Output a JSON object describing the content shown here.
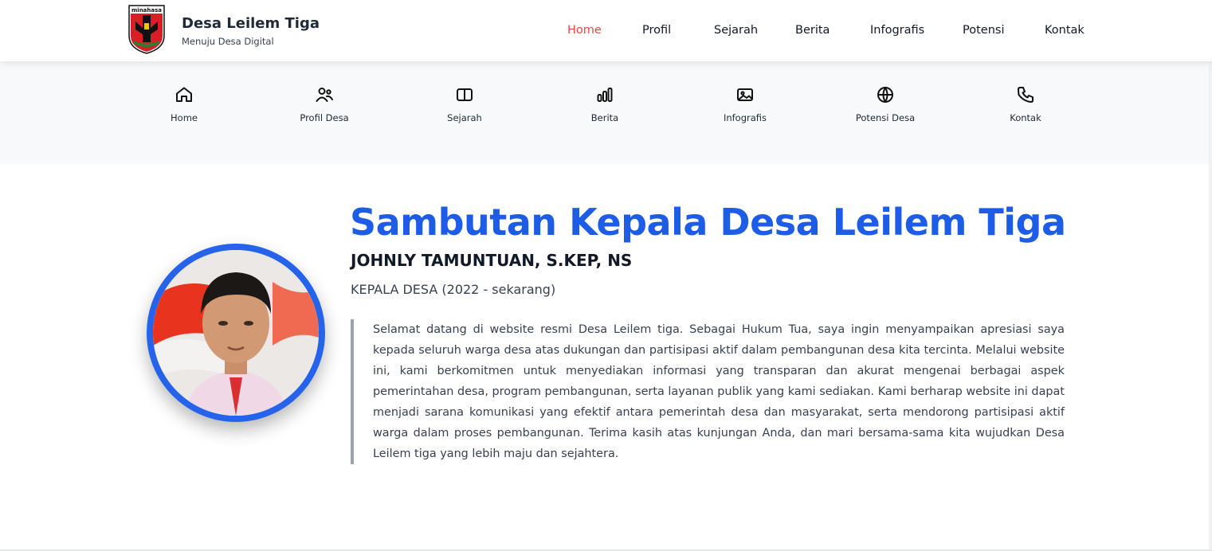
{
  "header": {
    "logo_text": "minahasa",
    "title": "Desa Leilem Tiga",
    "subtitle": "Menuju Desa Digital",
    "nav": [
      {
        "label": "Home",
        "active": true
      },
      {
        "label": "Profil",
        "active": false
      },
      {
        "label": "Sejarah",
        "active": false
      },
      {
        "label": "Berita",
        "active": false
      },
      {
        "label": "Infografis",
        "active": false
      },
      {
        "label": "Potensi",
        "active": false
      },
      {
        "label": "Kontak",
        "active": false
      }
    ],
    "active_color": "#ef4444"
  },
  "iconbar": {
    "items": [
      {
        "label": "Home",
        "icon": "home-icon"
      },
      {
        "label": "Profil Desa",
        "icon": "users-icon"
      },
      {
        "label": "Sejarah",
        "icon": "book-icon"
      },
      {
        "label": "Berita",
        "icon": "bar-chart-icon"
      },
      {
        "label": "Infografis",
        "icon": "image-icon"
      },
      {
        "label": "Potensi Desa",
        "icon": "globe-icon"
      },
      {
        "label": "Kontak",
        "icon": "phone-icon"
      }
    ]
  },
  "main": {
    "title": "Sambutan Kepala Desa Leilem Tiga",
    "name": "JOHNLY TAMUNTUAN, S.KEP, NS",
    "position": "KEPALA DESA (2022 - sekarang)",
    "message": "Selamat datang di website resmi Desa Leilem tiga. Sebagai Hukum Tua, saya ingin menyampaikan apresiasi saya kepada seluruh warga desa atas dukungan dan partisipasi aktif dalam pembangunan desa kita tercinta. Melalui website ini, kami berkomitmen untuk menyediakan informasi yang transparan dan akurat mengenai berbagai aspek pemerintahan desa, program pembangunan, serta layanan publik yang kami sediakan. Kami berharap website ini dapat menjadi sarana komunikasi yang efektif antara pemerintah desa dan masyarakat, serta mendorong partisipasi aktif warga dalam proses pembangunan. Terima kasih atas kunjungan Anda, dan mari bersama-sama kita wujudkan Desa Leilem tiga yang lebih maju dan sejahtera.",
    "title_color": "#1d5ce6",
    "photo_border_color": "#2563eb"
  }
}
